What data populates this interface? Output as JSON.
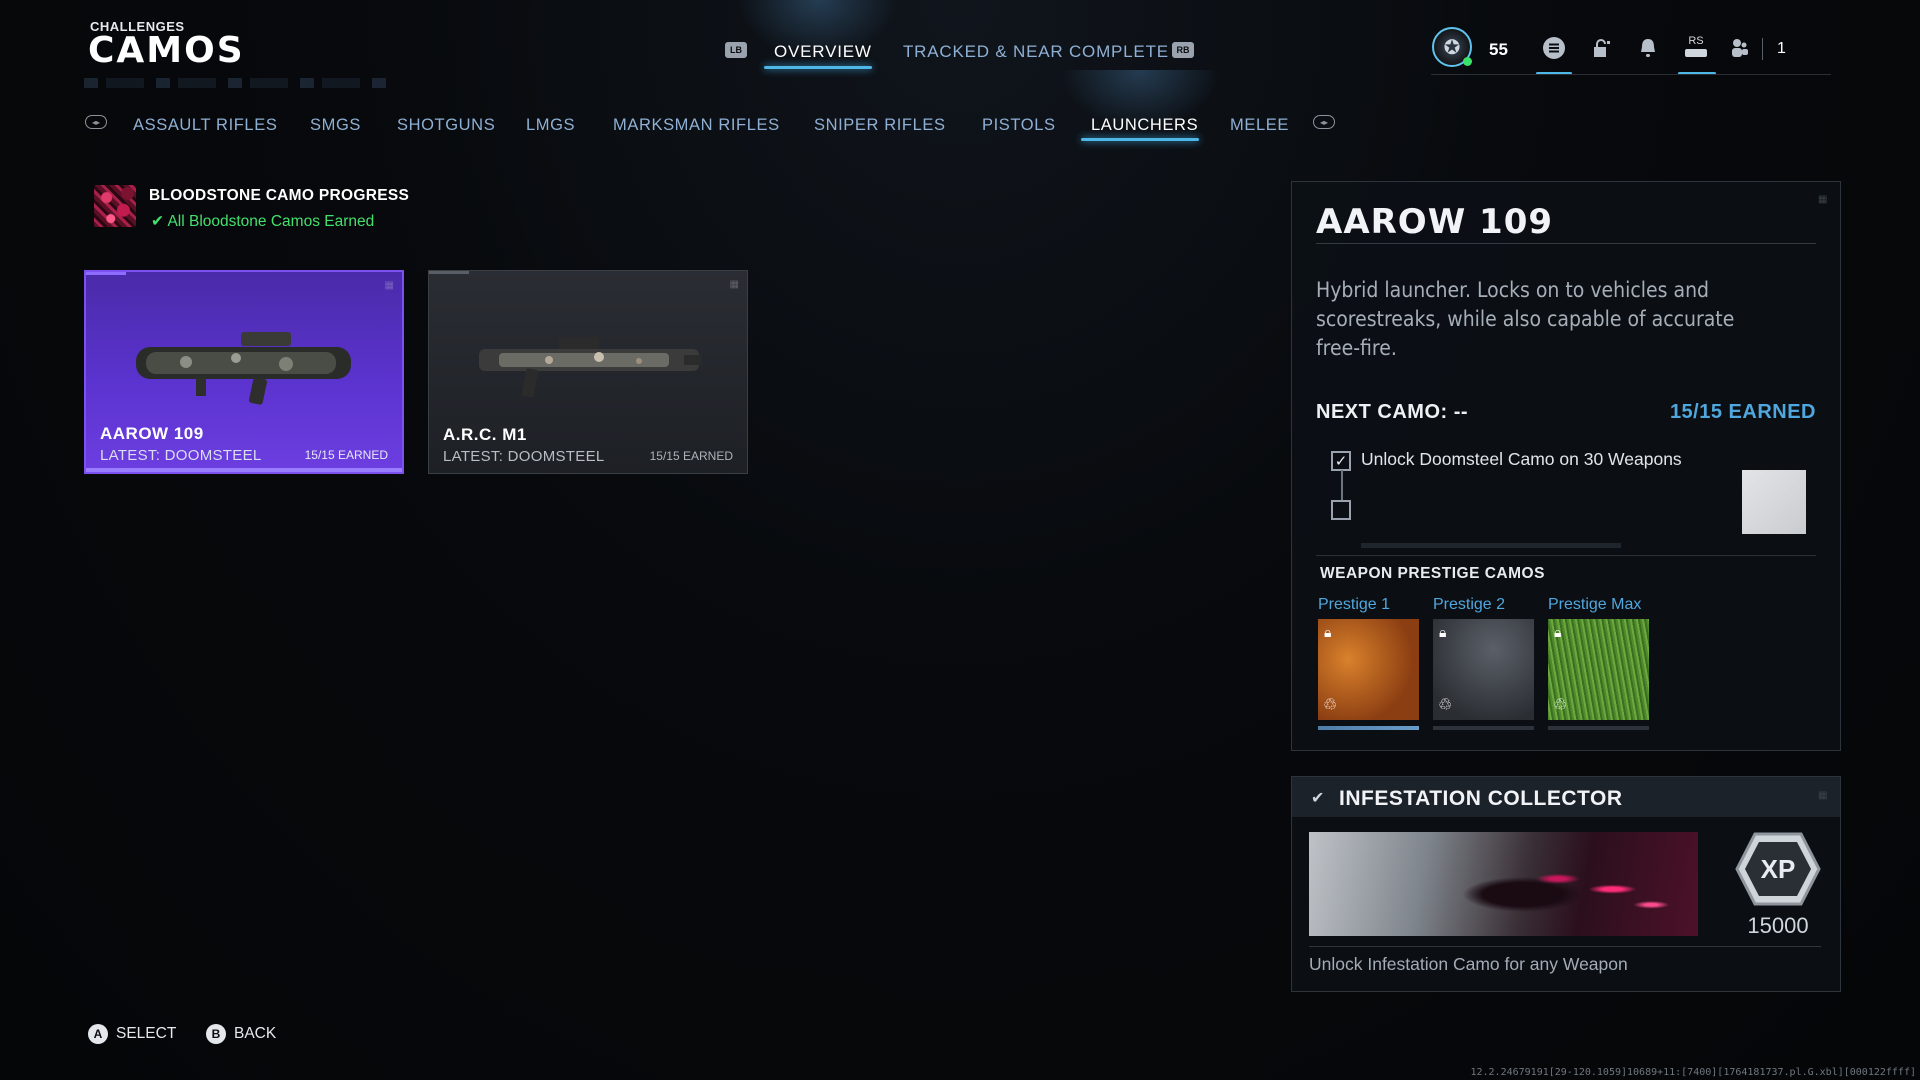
{
  "header": {
    "breadcrumb": "CHALLENGES",
    "title": "CAMOS",
    "left_bumper": "LB",
    "right_bumper": "RB",
    "tabs": [
      {
        "label": "OVERVIEW",
        "active": true
      },
      {
        "label": "TRACKED & NEAR COMPLETE",
        "active": false
      }
    ]
  },
  "hud": {
    "rank_level": "55",
    "rs_label": "RS",
    "party_count": "1",
    "icons": [
      "rank-icon",
      "menu-icon",
      "lock-icon",
      "bell-icon",
      "rs-icon",
      "party-icon"
    ]
  },
  "categories": {
    "items": [
      "ASSAULT RIFLES",
      "SMGS",
      "SHOTGUNS",
      "LMGS",
      "MARKSMAN RIFLES",
      "SNIPER RIFLES",
      "PISTOLS",
      "LAUNCHERS",
      "MELEE"
    ],
    "active": "LAUNCHERS"
  },
  "bloodstone": {
    "title": "BLOODSTONE CAMO PROGRESS",
    "status": "All Bloodstone Camos Earned",
    "status_color": "#44e06c"
  },
  "weapons": [
    {
      "name": "AAROW 109",
      "latest": "LATEST: DOOMSTEEL",
      "earned": "15/15 EARNED",
      "selected": true
    },
    {
      "name": "A.R.C. M1",
      "latest": "LATEST: DOOMSTEEL",
      "earned": "15/15 EARNED",
      "selected": false
    }
  ],
  "detail": {
    "title": "AAROW 109",
    "description": "Hybrid launcher. Locks on to vehicles and scorestreaks, while also capable of accurate free-fire.",
    "next_camo": "NEXT CAMO: --",
    "earned": "15/15 EARNED",
    "requirement": "Unlock Doomsteel Camo on 30 Weapons",
    "requirement_checked": true,
    "prestige_title": "WEAPON PRESTIGE CAMOS",
    "prestige": [
      {
        "label": "Prestige 1",
        "locked": true
      },
      {
        "label": "Prestige 2",
        "locked": true
      },
      {
        "label": "Prestige Max",
        "locked": true
      }
    ]
  },
  "collector": {
    "title": "INFESTATION COLLECTOR",
    "xp_label": "XP",
    "xp_value": "15000",
    "description": "Unlock Infestation Camo for any Weapon"
  },
  "footer": {
    "select_key": "A",
    "select_label": "SELECT",
    "back_key": "B",
    "back_label": "BACK",
    "build": "12.2.24679191[29-120.1059]10689+11:[7400][1764181737.pl.G.xbl][000122ffff]"
  },
  "colors": {
    "accent": "#4fb6e8",
    "selected_card": "#5b33cf",
    "earned_blue": "#4fa7dd"
  }
}
